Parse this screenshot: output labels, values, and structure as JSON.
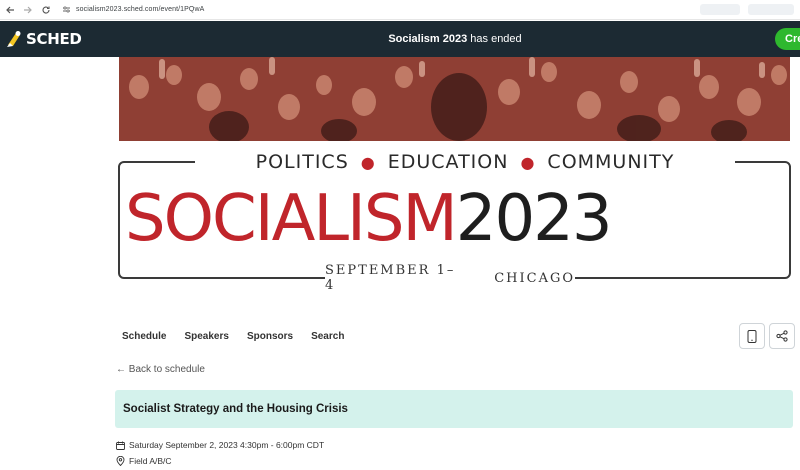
{
  "browser": {
    "url": "socialism2023.sched.com/event/1PQwA"
  },
  "header": {
    "logo_text": "SCHED",
    "event_name": "Socialism 2023",
    "event_status": "has ended",
    "create_label": "Cre",
    "accent_color": "#2eb82e"
  },
  "banner": {
    "tagline_1": "POLITICS",
    "tagline_2": "EDUCATION",
    "tagline_3": "COMMUNITY",
    "title_red": "SOCIALISM",
    "title_dark": "2023",
    "dates": "SEPTEMBER 1–4",
    "city": "CHICAGO",
    "red_color": "#c0252b"
  },
  "nav": {
    "items": [
      {
        "label": "Schedule"
      },
      {
        "label": "Speakers"
      },
      {
        "label": "Sponsors"
      },
      {
        "label": "Search"
      }
    ]
  },
  "back_link": "← Back to schedule",
  "session": {
    "title": "Socialist Strategy and the Housing Crisis",
    "datetime": "Saturday September 2, 2023 4:30pm - 6:00pm CDT",
    "location": "Field A/B/C"
  }
}
